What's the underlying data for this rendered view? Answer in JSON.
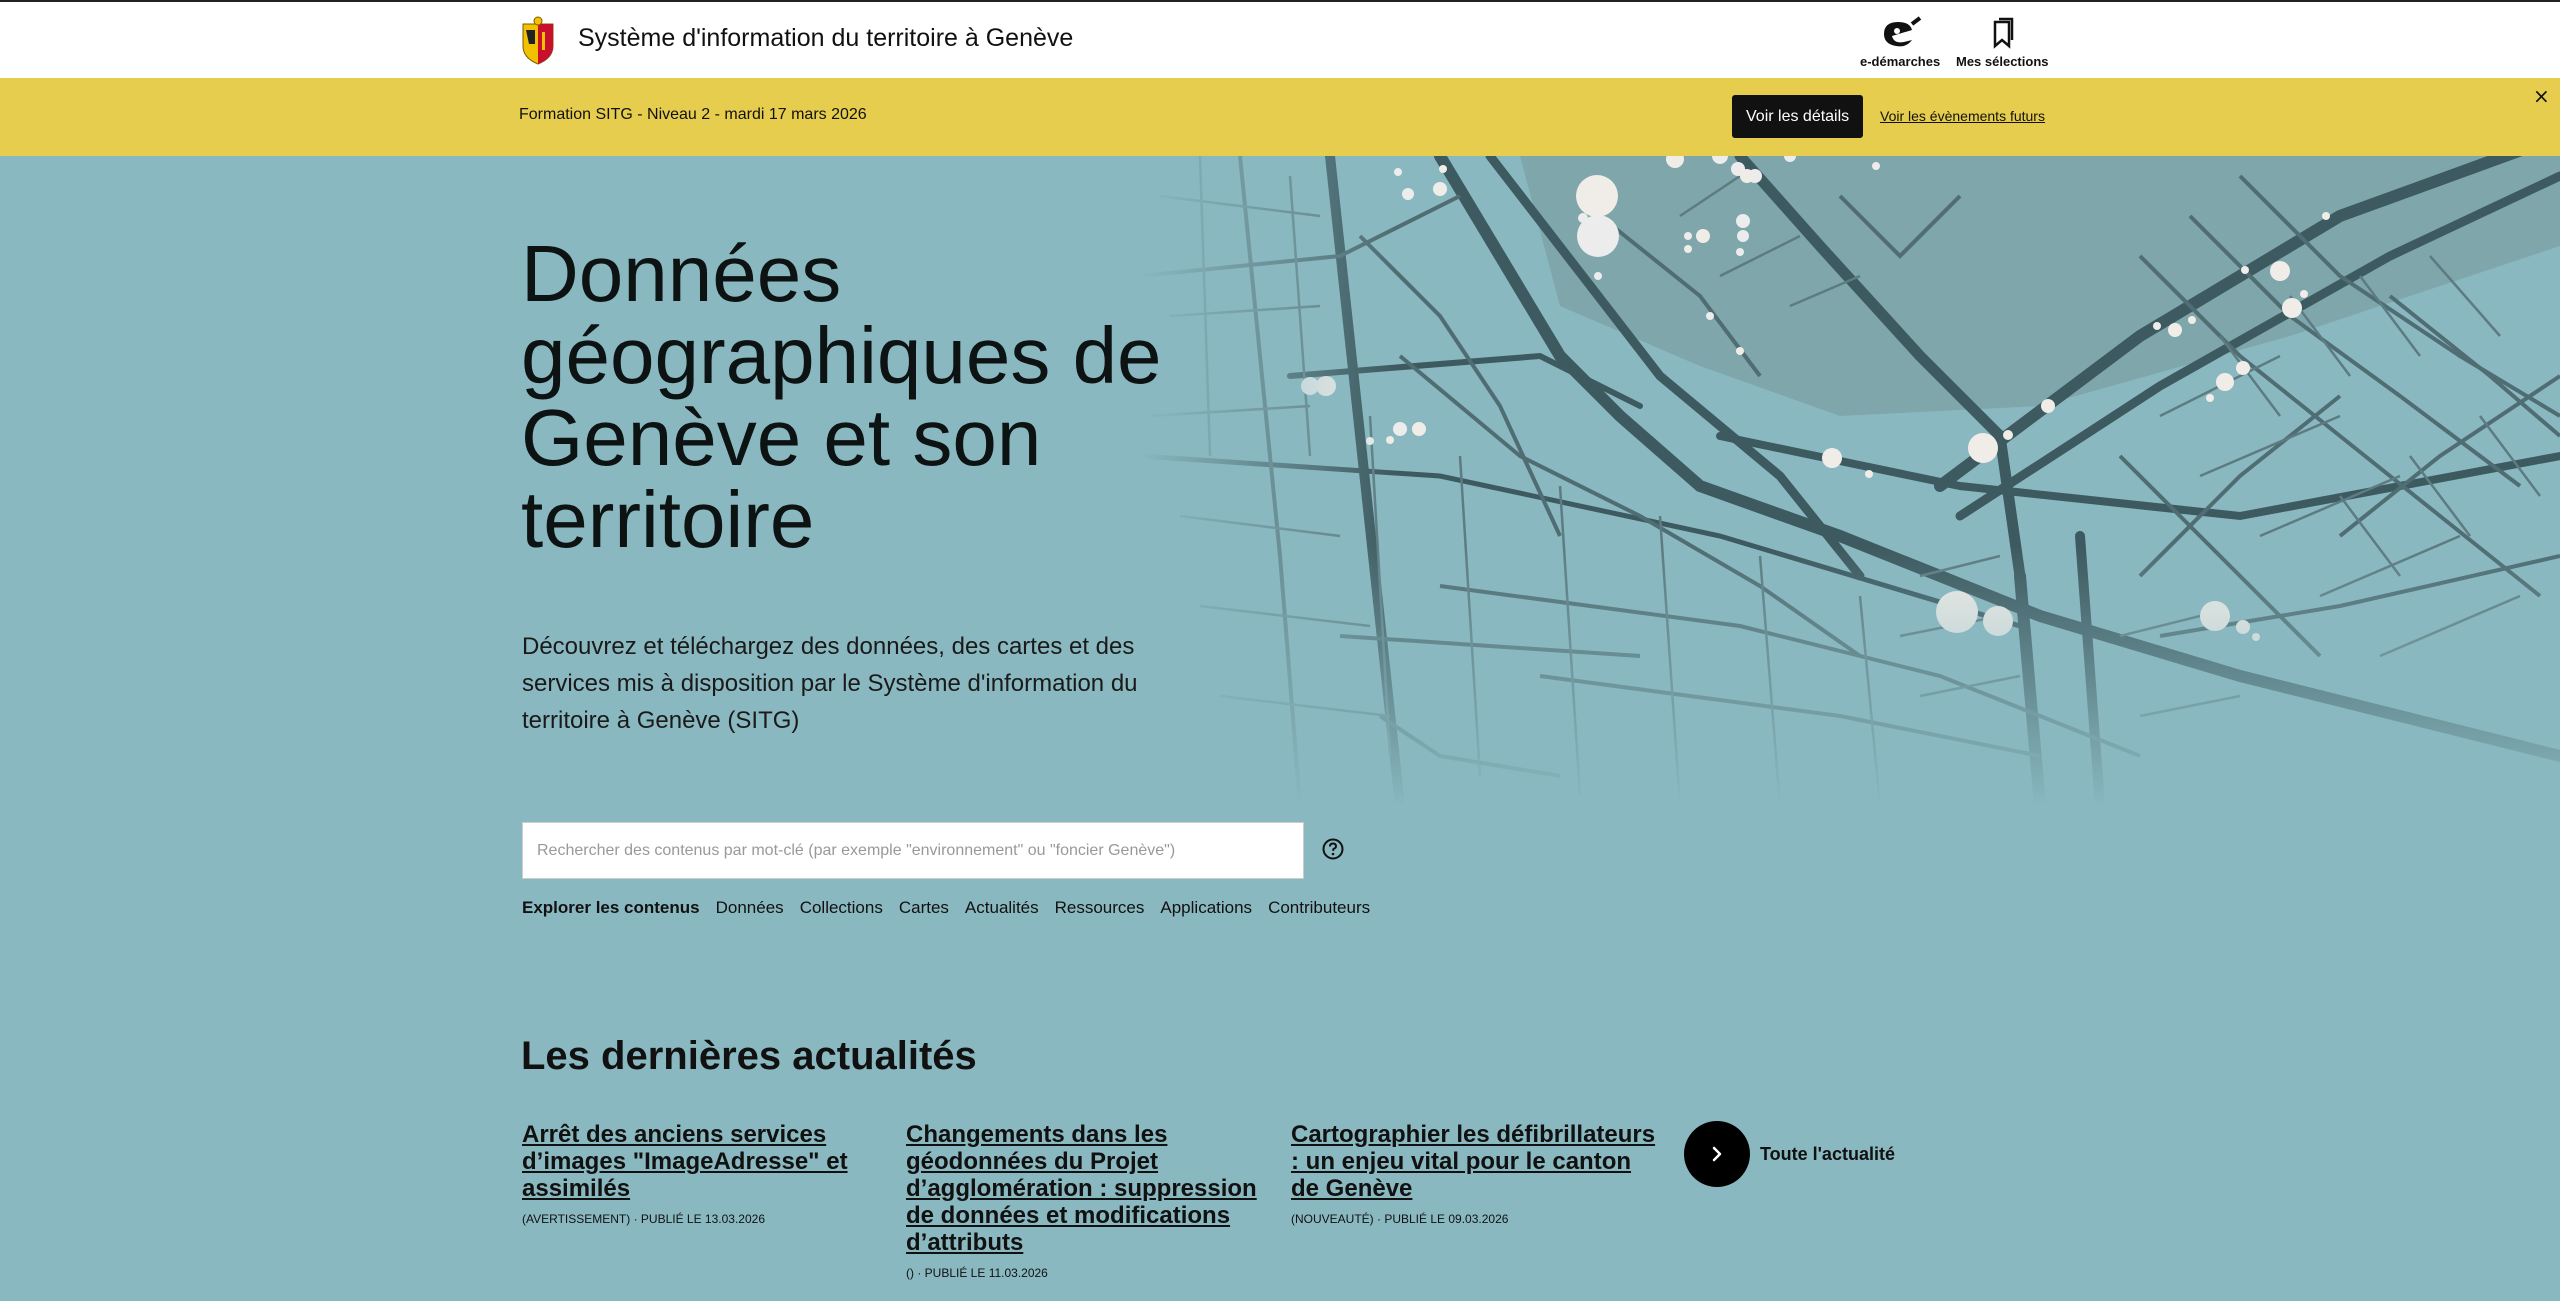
{
  "header": {
    "site_title": "Système d'information du territoire à Genève",
    "edemarches_label": "e-démarches",
    "selections_label": "Mes sélections"
  },
  "banner": {
    "text": "Formation SITG - Niveau 2 - mardi 17 mars 2026",
    "details_button": "Voir les détails",
    "future_events_link": "Voir les évènements futurs",
    "close_glyph": "×"
  },
  "hero": {
    "title": "Données géographiques de Genève et son territoire",
    "description": "Découvrez et téléchargez des données, des cartes et des services mis à disposition par le Système d'information du territoire à Genève (SITG)"
  },
  "search": {
    "placeholder": "Rechercher des contenus par mot-clé (par exemple \"environnement\" ou \"foncier Genève\")",
    "value": ""
  },
  "explore": {
    "label": "Explorer les contenus",
    "links": [
      "Données",
      "Collections",
      "Cartes",
      "Actualités",
      "Ressources",
      "Applications",
      "Contributeurs"
    ]
  },
  "news": {
    "heading": "Les dernières actualités",
    "items": [
      {
        "title": "Arrêt des anciens services d’images \"ImageAdresse\" et assimilés",
        "meta": "(AVERTISSEMENT) · PUBLIÉ LE 13.03.2026"
      },
      {
        "title": "Changements dans les géodonnées du Projet d’agglomération : suppression de données et modifications d’attributs",
        "meta": "() · PUBLIÉ LE 11.03.2026"
      },
      {
        "title": "Cartographier les défibrillateurs : un enjeu vital pour le canton de Genève",
        "meta": "(NOUVEAUTÉ) · PUBLIÉ LE 09.03.2026"
      }
    ],
    "all_label": "Toute l'actualité"
  },
  "colors": {
    "background": "#8ab8c0",
    "banner": "#e6cd4d",
    "map_streets": "#3d5a60"
  }
}
